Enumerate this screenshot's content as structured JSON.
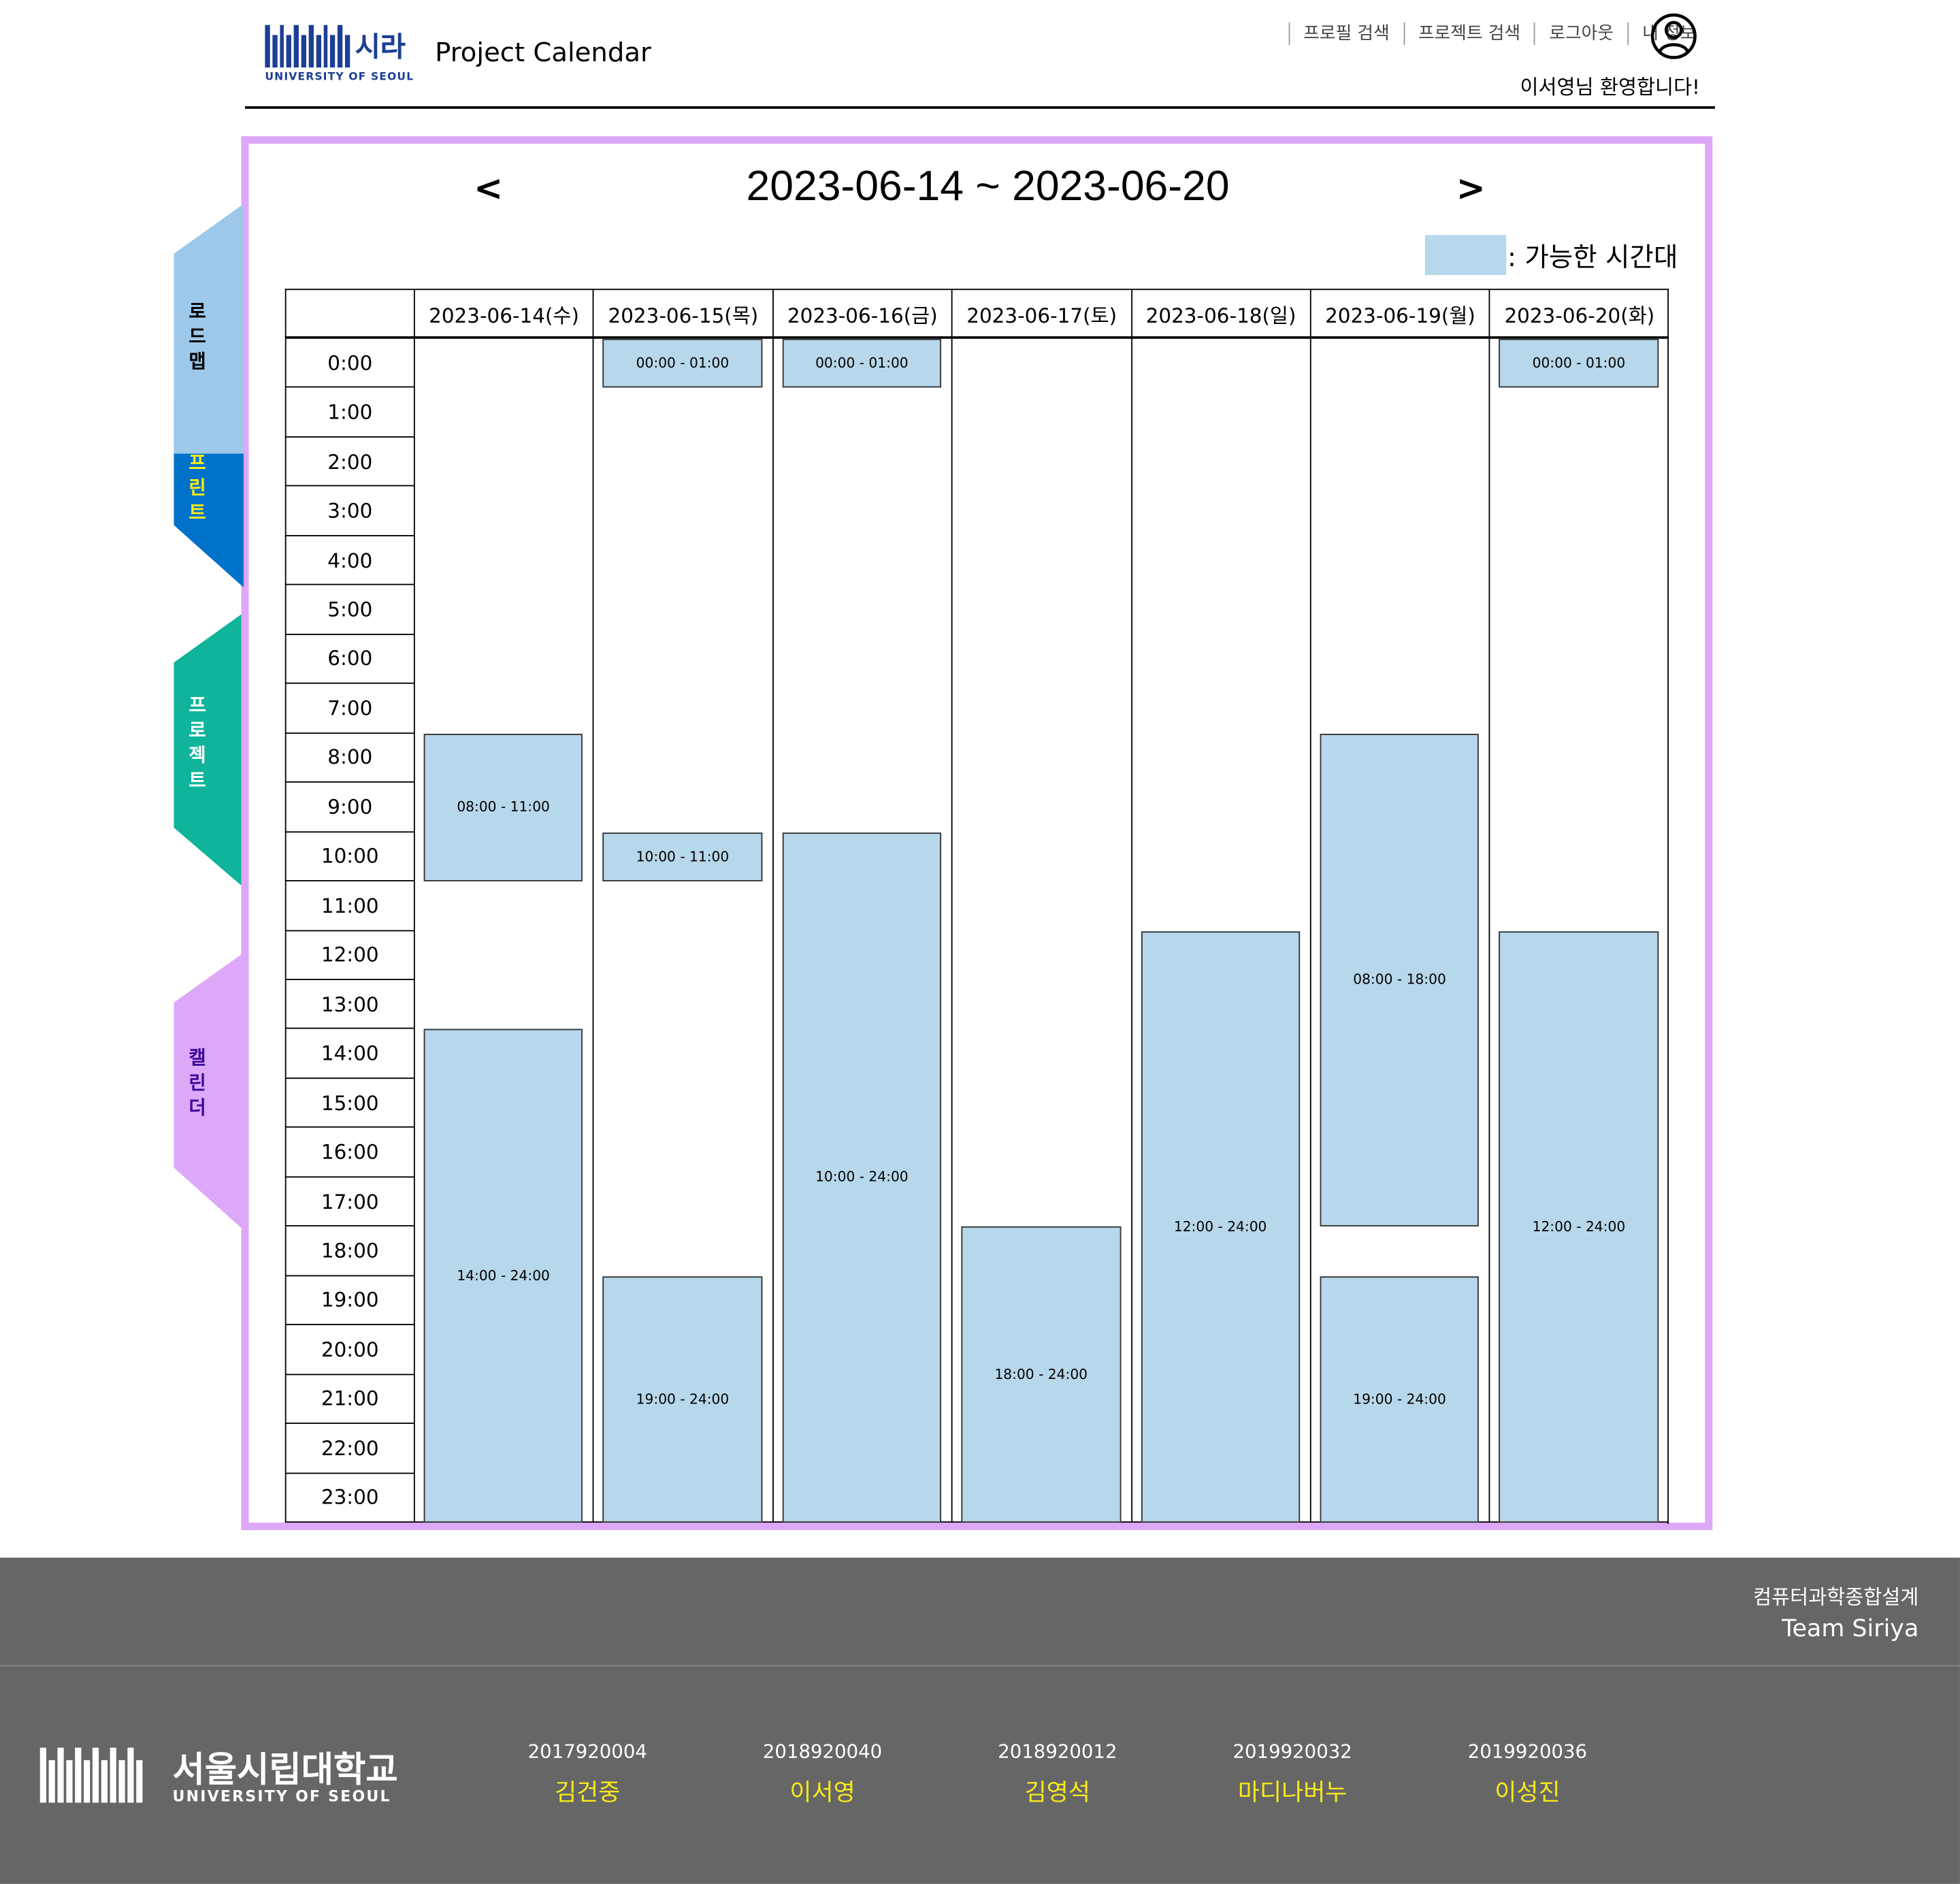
{
  "header": {
    "logo_kr": "시라",
    "logo_en": "UNIVERSITY OF SEOUL",
    "app_title": "Project Calendar",
    "nav": [
      "프로필 검색",
      "프로젝트 검색",
      "로그아웃",
      "내 정보"
    ],
    "welcome": "이서영님 환영합니다!"
  },
  "side_tabs": [
    {
      "label": "로드맵",
      "color": "#9dc8ea"
    },
    {
      "label": "스프린트",
      "color": "#0072c9"
    },
    {
      "label": "프로젝트",
      "color": "#0fb49a"
    },
    {
      "label": "캘린더",
      "color": "#dea8f9"
    }
  ],
  "calendar": {
    "range_title": "2023-06-14 ~ 2023-06-20",
    "prev": "<",
    "next": ">",
    "legend_label": ": 가능한 시간대",
    "available_color": "#b7d7ea",
    "frame_color": "#dea8f9",
    "days": [
      "2023-06-14(수)",
      "2023-06-15(목)",
      "2023-06-16(금)",
      "2023-06-17(토)",
      "2023-06-18(일)",
      "2023-06-19(월)",
      "2023-06-20(화)"
    ],
    "hours": [
      "0:00",
      "1:00",
      "2:00",
      "3:00",
      "4:00",
      "5:00",
      "6:00",
      "7:00",
      "8:00",
      "9:00",
      "10:00",
      "11:00",
      "12:00",
      "13:00",
      "14:00",
      "15:00",
      "16:00",
      "17:00",
      "18:00",
      "19:00",
      "20:00",
      "21:00",
      "22:00",
      "23:00"
    ],
    "slots": [
      {
        "day": 0,
        "start": 8,
        "end": 11,
        "label": "08:00 - 11:00"
      },
      {
        "day": 0,
        "start": 14,
        "end": 24,
        "label": "14:00 - 24:00"
      },
      {
        "day": 1,
        "start": 0,
        "end": 1,
        "label": "00:00 - 01:00"
      },
      {
        "day": 1,
        "start": 10,
        "end": 11,
        "label": "10:00 - 11:00"
      },
      {
        "day": 1,
        "start": 19,
        "end": 24,
        "label": "19:00 - 24:00"
      },
      {
        "day": 2,
        "start": 0,
        "end": 1,
        "label": "00:00 - 01:00"
      },
      {
        "day": 2,
        "start": 10,
        "end": 24,
        "label": "10:00 - 24:00"
      },
      {
        "day": 3,
        "start": 18,
        "end": 24,
        "label": "18:00 - 24:00"
      },
      {
        "day": 4,
        "start": 12,
        "end": 24,
        "label": "12:00 - 24:00"
      },
      {
        "day": 5,
        "start": 8,
        "end": 18,
        "label": "08:00 - 18:00"
      },
      {
        "day": 5,
        "start": 19,
        "end": 24,
        "label": "19:00 - 24:00"
      },
      {
        "day": 6,
        "start": 0,
        "end": 1,
        "label": "00:00 - 01:00"
      },
      {
        "day": 6,
        "start": 12,
        "end": 24,
        "label": "12:00 - 24:00"
      }
    ]
  },
  "footer": {
    "course": "컴퓨터과학종합설계",
    "team": "Team Siriya",
    "logo_kr": "서울시립대학교",
    "logo_en": "UNIVERSITY OF SEOUL",
    "members": [
      {
        "id": "2017920004",
        "name": "김건중"
      },
      {
        "id": "2018920040",
        "name": "이서영"
      },
      {
        "id": "2018920012",
        "name": "김영석"
      },
      {
        "id": "2019920032",
        "name": "마디나버누"
      },
      {
        "id": "2019920036",
        "name": "이성진"
      }
    ]
  }
}
